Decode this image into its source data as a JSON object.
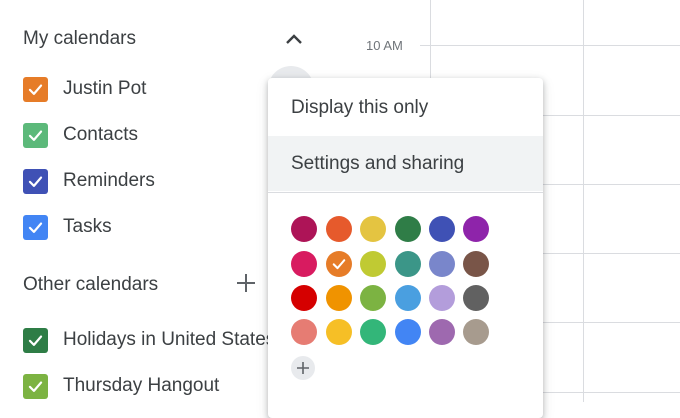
{
  "sidebar": {
    "my_calendars_title": "My calendars",
    "other_calendars_title": "Other calendars",
    "my_calendars": [
      {
        "label": "Justin Pot",
        "color": "#e67c28"
      },
      {
        "label": "Contacts",
        "color": "#5cb97a"
      },
      {
        "label": "Reminders",
        "color": "#3f51b5"
      },
      {
        "label": "Tasks",
        "color": "#4285f4"
      }
    ],
    "other_calendars": [
      {
        "label": "Holidays in United States",
        "color": "#2e7d46"
      },
      {
        "label": "Thursday Hangout",
        "color": "#7cb342"
      }
    ]
  },
  "grid": {
    "time_label": "10 AM"
  },
  "menu": {
    "items": [
      {
        "label": "Display this only"
      },
      {
        "label": "Settings and sharing"
      }
    ],
    "selected_color_index": 7,
    "colors": [
      "#ad1457",
      "#e65a2c",
      "#e4c441",
      "#2f7d47",
      "#3f51b5",
      "#8e24aa",
      "#d81b60",
      "#e67c28",
      "#c0ca33",
      "#3b9688",
      "#7986cb",
      "#795548",
      "#d50000",
      "#f09300",
      "#7cb342",
      "#4a9fe0",
      "#b39ddb",
      "#616161",
      "#e67c73",
      "#f6bf26",
      "#33b679",
      "#4285f4",
      "#9e69af",
      "#a79b8e"
    ]
  }
}
